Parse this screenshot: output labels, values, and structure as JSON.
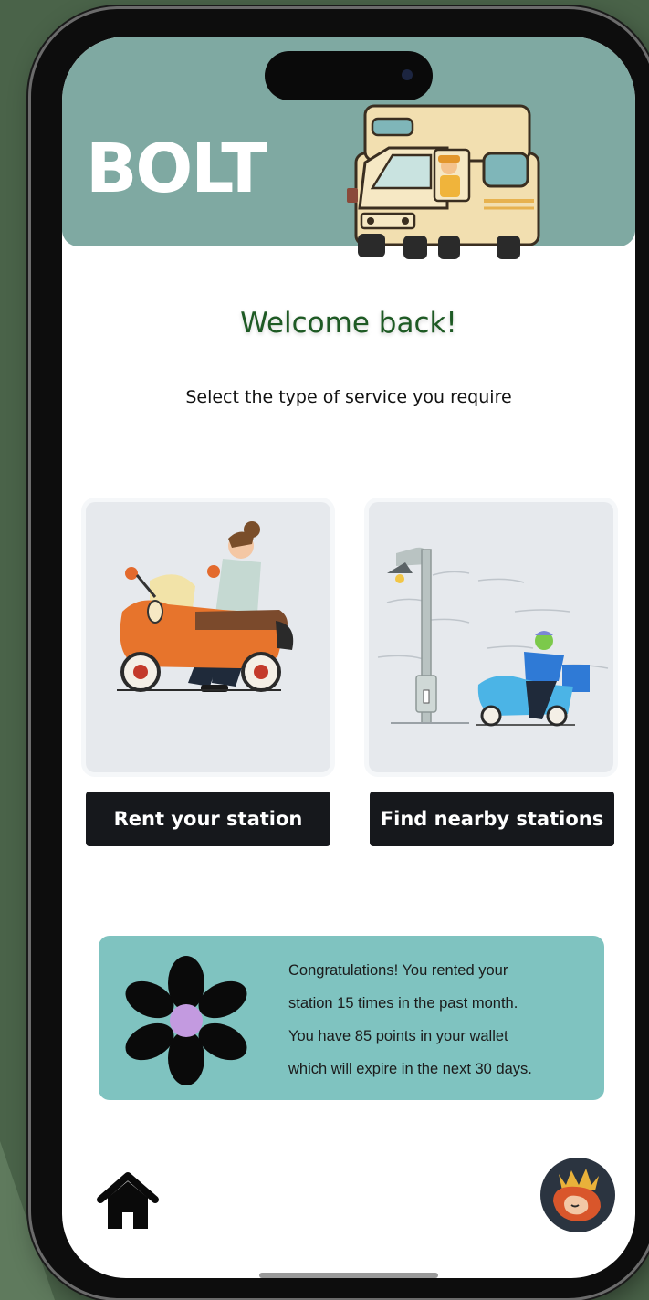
{
  "app": {
    "brand": "BOLT"
  },
  "main": {
    "welcome": "Welcome back!",
    "subtitle": "Select the type of service you require",
    "services": [
      {
        "label": "Rent your station",
        "illustration": "person-on-scooter"
      },
      {
        "label": "Find nearby stations",
        "illustration": "street-lamp-scooter"
      }
    ]
  },
  "banner": {
    "icon": "flower-icon",
    "text": "Congratulations! You rented your\nstation 15 times in the past month.\nYou have 85 points in your wallet\nwhich will expire in the next 30 days."
  },
  "bottom_nav": {
    "home_icon": "home-icon",
    "avatar_icon": "profile-avatar"
  },
  "colors": {
    "header": "#7fa9a2",
    "welcome_text": "#1e5a24",
    "button": "#16181c",
    "banner": "#7fc3c0",
    "background": "#4a6349"
  }
}
